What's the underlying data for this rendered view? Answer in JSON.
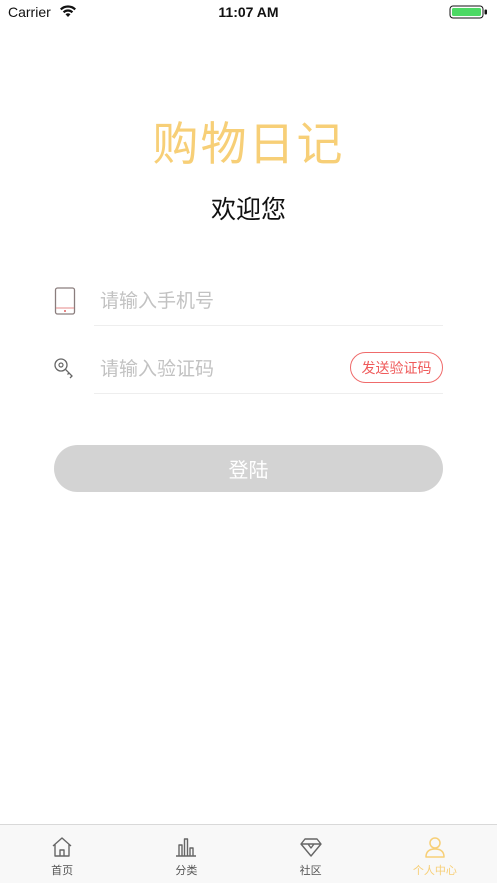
{
  "status_bar": {
    "carrier": "Carrier",
    "time": "11:07 AM",
    "battery_color": "#4cd964"
  },
  "app": {
    "title": "购物日记",
    "welcome": "欢迎您",
    "title_color": "#f7cf77"
  },
  "form": {
    "phone": {
      "placeholder": "请输入手机号",
      "value": "",
      "icon": "phone-icon"
    },
    "code": {
      "placeholder": "请输入验证码",
      "value": "",
      "icon": "key-icon"
    },
    "send_code_label": "发送验证码",
    "login_label": "登陆"
  },
  "tabs": [
    {
      "label": "首页",
      "icon": "home-icon",
      "active": false
    },
    {
      "label": "分类",
      "icon": "chart-icon",
      "active": false
    },
    {
      "label": "社区",
      "icon": "diamond-icon",
      "active": false
    },
    {
      "label": "个人中心",
      "icon": "user-icon",
      "active": true
    }
  ],
  "colors": {
    "accent": "#f7cf77",
    "send_code": "#ef5a5a",
    "login_disabled": "#d3d3d3"
  }
}
